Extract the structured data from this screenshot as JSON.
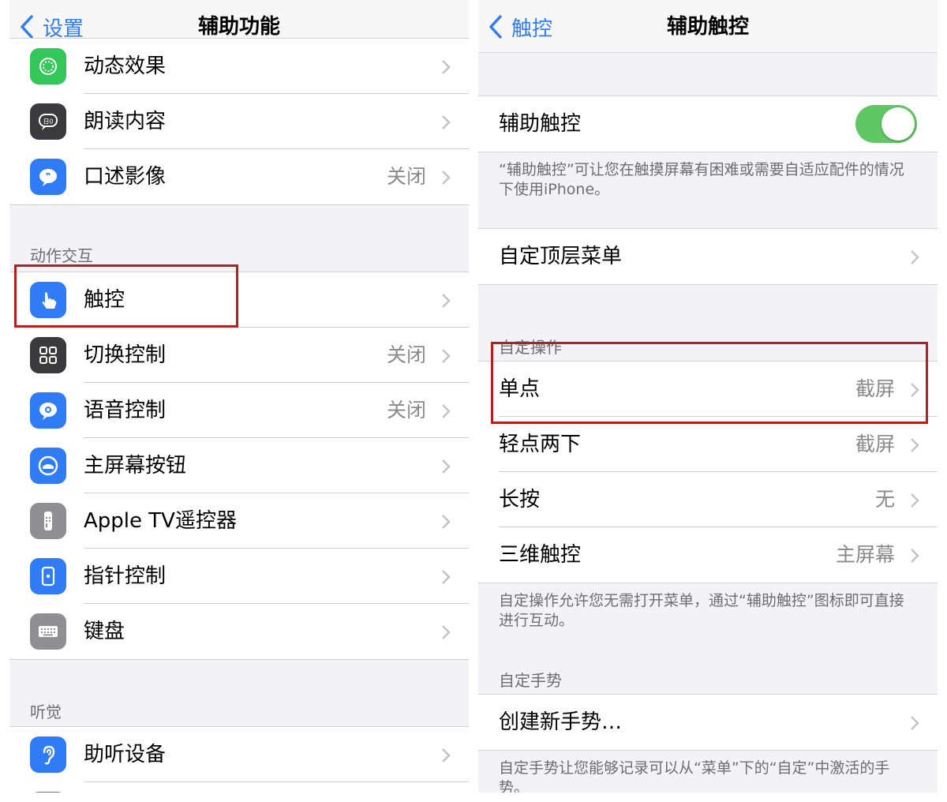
{
  "left": {
    "back_label": "设置",
    "title": "辅助功能",
    "group1": [
      {
        "label": "动态效果",
        "value": "",
        "icon": "motion-icon",
        "color": "#34c759"
      },
      {
        "label": "朗读内容",
        "value": "",
        "icon": "speech-bubble-icon",
        "color": "#3a3a3c"
      },
      {
        "label": "口述影像",
        "value": "关闭",
        "icon": "audio-description-icon",
        "color": "#2f7cf6"
      }
    ],
    "section_interaction": "动作交互",
    "group2": [
      {
        "label": "触控",
        "value": "",
        "icon": "hand-touch-icon",
        "color": "#2f7cf6"
      },
      {
        "label": "切换控制",
        "value": "关闭",
        "icon": "switch-grid-icon",
        "color": "#3a3a3c"
      },
      {
        "label": "语音控制",
        "value": "关闭",
        "icon": "voice-control-icon",
        "color": "#2f7cf6"
      },
      {
        "label": "主屏幕按钮",
        "value": "",
        "icon": "home-button-icon",
        "color": "#2f7cf6"
      },
      {
        "label": "Apple TV遥控器",
        "value": "",
        "icon": "tv-remote-icon",
        "color": "#8e8e93"
      },
      {
        "label": "指针控制",
        "value": "",
        "icon": "pointer-control-icon",
        "color": "#2f7cf6"
      },
      {
        "label": "键盘",
        "value": "",
        "icon": "keyboard-icon",
        "color": "#8e8e93"
      }
    ],
    "section_hearing": "听觉",
    "group3": [
      {
        "label": "助听设备",
        "value": "",
        "icon": "ear-icon",
        "color": "#2f7cf6"
      }
    ]
  },
  "right": {
    "back_label": "触控",
    "title": "辅助触控",
    "assistive_touch_label": "辅助触控",
    "assistive_touch_on": true,
    "assistive_touch_desc": "“辅助触控”可让您在触摸屏幕有困难或需要自适应配件的情况下使用iPhone。",
    "top_menu_label": "自定顶层菜单",
    "section_custom_actions": "自定操作",
    "actions": [
      {
        "label": "单点",
        "value": "截屏"
      },
      {
        "label": "轻点两下",
        "value": "截屏"
      },
      {
        "label": "长按",
        "value": "无"
      },
      {
        "label": "三维触控",
        "value": "主屏幕"
      }
    ],
    "actions_footer": "自定操作允许您无需打开菜单，通过“辅助触控”图标即可直接进行互动。",
    "section_custom_gestures": "自定手势",
    "create_gesture_label": "创建新手势…",
    "gestures_footer": "自定手势让您能够记录可以从“菜单”下的“自定”中激活的手势。"
  },
  "colors": {
    "accent": "#2f7cf6",
    "toggle_on": "#5fc864",
    "highlight": "#b3211e"
  }
}
